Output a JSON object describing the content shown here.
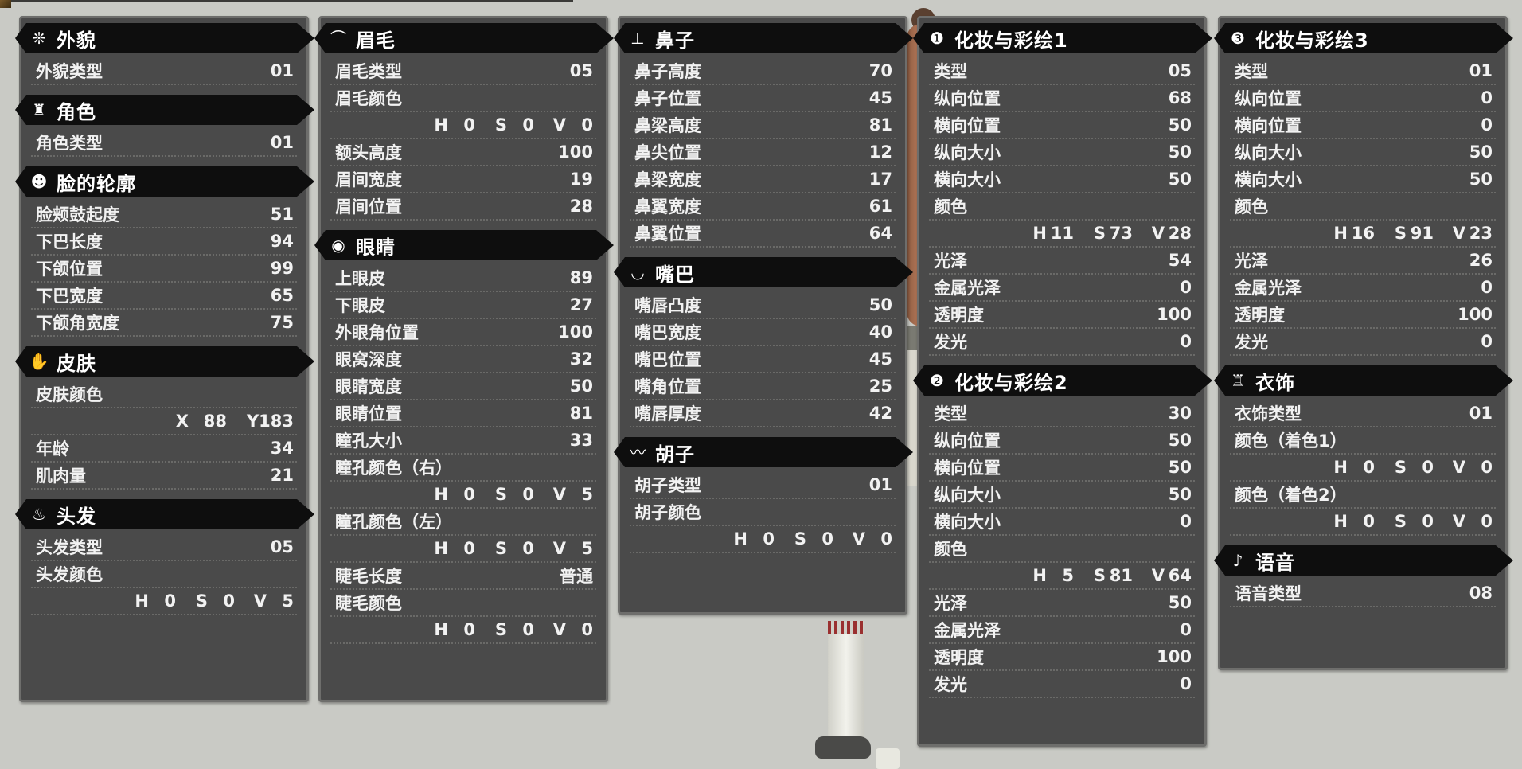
{
  "colors": {
    "panel": "#4a4a4a",
    "banner": "#0e0e0e",
    "text": "#f2f2f2",
    "background": "#c9cac5"
  },
  "col1": {
    "appearance": {
      "title": "外貌",
      "icon": "appearance-icon",
      "rows": [
        {
          "label": "外貌类型",
          "value": "01"
        }
      ]
    },
    "role": {
      "title": "角色",
      "icon": "character-icon",
      "rows": [
        {
          "label": "角色类型",
          "value": "01"
        }
      ]
    },
    "face": {
      "title": "脸的轮廓",
      "icon": "face-icon",
      "rows": [
        {
          "label": "脸颊鼓起度",
          "value": "51"
        },
        {
          "label": "下巴长度",
          "value": "94"
        },
        {
          "label": "下颌位置",
          "value": "99"
        },
        {
          "label": "下巴宽度",
          "value": "65"
        },
        {
          "label": "下颌角宽度",
          "value": "75"
        }
      ]
    },
    "skin": {
      "title": "皮肤",
      "icon": "hand-icon",
      "color_label": "皮肤颜色",
      "x_label": "X",
      "x_value": "88",
      "y_label": "Y183",
      "age": {
        "label": "年龄",
        "value": "34"
      },
      "muscle": {
        "label": "肌肉量",
        "value": "21"
      }
    },
    "hair": {
      "title": "头发",
      "icon": "hair-icon",
      "type": {
        "label": "头发类型",
        "value": "05"
      },
      "color_label": "头发颜色",
      "hsv": {
        "h": "0",
        "s": "0",
        "v": "5"
      }
    }
  },
  "col2": {
    "eyebrow": {
      "title": "眉毛",
      "icon": "eyebrow-icon",
      "type": {
        "label": "眉毛类型",
        "value": "05"
      },
      "color_label": "眉毛颜色",
      "hsv": {
        "h": "0",
        "s": "0",
        "v": "0"
      },
      "rows": [
        {
          "label": "额头高度",
          "value": "100"
        },
        {
          "label": "眉间宽度",
          "value": "19"
        },
        {
          "label": "眉间位置",
          "value": "28"
        }
      ]
    },
    "eyes": {
      "title": "眼睛",
      "icon": "eye-icon",
      "rows": [
        {
          "label": "上眼皮",
          "value": "89"
        },
        {
          "label": "下眼皮",
          "value": "27"
        },
        {
          "label": "外眼角位置",
          "value": "100"
        },
        {
          "label": "眼窝深度",
          "value": "32"
        },
        {
          "label": "眼睛宽度",
          "value": "50"
        },
        {
          "label": "眼睛位置",
          "value": "81"
        },
        {
          "label": "瞳孔大小",
          "value": "33"
        }
      ],
      "pupil_right_label": "瞳孔颜色（右）",
      "pupil_right_hsv": {
        "h": "0",
        "s": "0",
        "v": "5"
      },
      "pupil_left_label": "瞳孔颜色（左）",
      "pupil_left_hsv": {
        "h": "0",
        "s": "0",
        "v": "5"
      },
      "lash_length": {
        "label": "睫毛长度",
        "value": "普通"
      },
      "lash_color_label": "睫毛颜色",
      "lash_hsv": {
        "h": "0",
        "s": "0",
        "v": "0"
      }
    }
  },
  "col3": {
    "nose": {
      "title": "鼻子",
      "icon": "nose-icon",
      "rows": [
        {
          "label": "鼻子高度",
          "value": "70"
        },
        {
          "label": "鼻子位置",
          "value": "45"
        },
        {
          "label": "鼻梁高度",
          "value": "81"
        },
        {
          "label": "鼻尖位置",
          "value": "12"
        },
        {
          "label": "鼻梁宽度",
          "value": "17"
        },
        {
          "label": "鼻翼宽度",
          "value": "61"
        },
        {
          "label": "鼻翼位置",
          "value": "64"
        }
      ]
    },
    "mouth": {
      "title": "嘴巴",
      "icon": "mouth-icon",
      "rows": [
        {
          "label": "嘴唇凸度",
          "value": "50"
        },
        {
          "label": "嘴巴宽度",
          "value": "40"
        },
        {
          "label": "嘴巴位置",
          "value": "45"
        },
        {
          "label": "嘴角位置",
          "value": "25"
        },
        {
          "label": "嘴唇厚度",
          "value": "42"
        }
      ]
    },
    "beard": {
      "title": "胡子",
      "icon": "mustache-icon",
      "type": {
        "label": "胡子类型",
        "value": "01"
      },
      "color_label": "胡子颜色",
      "hsv": {
        "h": "0",
        "s": "0",
        "v": "0"
      }
    }
  },
  "col4": {
    "makeup1": {
      "title": "化妆与彩绘1",
      "icon": "makeup-1-icon",
      "rows_top": [
        {
          "label": "类型",
          "value": "05"
        },
        {
          "label": "纵向位置",
          "value": "68"
        },
        {
          "label": "横向位置",
          "value": "50"
        },
        {
          "label": "纵向大小",
          "value": "50"
        },
        {
          "label": "横向大小",
          "value": "50"
        }
      ],
      "color_label": "颜色",
      "hsv": {
        "h": "11",
        "s": "73",
        "v": "28"
      },
      "rows_bottom": [
        {
          "label": "光泽",
          "value": "54"
        },
        {
          "label": "金属光泽",
          "value": "0"
        },
        {
          "label": "透明度",
          "value": "100"
        },
        {
          "label": "发光",
          "value": "0"
        }
      ]
    },
    "makeup2": {
      "title": "化妆与彩绘2",
      "icon": "makeup-2-icon",
      "rows_top": [
        {
          "label": "类型",
          "value": "30"
        },
        {
          "label": "纵向位置",
          "value": "50"
        },
        {
          "label": "横向位置",
          "value": "50"
        },
        {
          "label": "纵向大小",
          "value": "50"
        },
        {
          "label": "横向大小",
          "value": "0"
        }
      ],
      "color_label": "颜色",
      "hsv": {
        "h": "5",
        "s": "81",
        "v": "64"
      },
      "rows_bottom": [
        {
          "label": "光泽",
          "value": "50"
        },
        {
          "label": "金属光泽",
          "value": "0"
        },
        {
          "label": "透明度",
          "value": "100"
        },
        {
          "label": "发光",
          "value": "0"
        }
      ]
    }
  },
  "col5": {
    "makeup3": {
      "title": "化妆与彩绘3",
      "icon": "makeup-3-icon",
      "rows_top": [
        {
          "label": "类型",
          "value": "01"
        },
        {
          "label": "纵向位置",
          "value": "0"
        },
        {
          "label": "横向位置",
          "value": "0"
        },
        {
          "label": "纵向大小",
          "value": "50"
        },
        {
          "label": "横向大小",
          "value": "50"
        }
      ],
      "color_label": "颜色",
      "hsv": {
        "h": "16",
        "s": "91",
        "v": "23"
      },
      "rows_bottom": [
        {
          "label": "光泽",
          "value": "26"
        },
        {
          "label": "金属光泽",
          "value": "0"
        },
        {
          "label": "透明度",
          "value": "100"
        },
        {
          "label": "发光",
          "value": "0"
        }
      ]
    },
    "outfit": {
      "title": "衣饰",
      "icon": "outfit-icon",
      "type": {
        "label": "衣饰类型",
        "value": "01"
      },
      "color1_label": "颜色（着色1）",
      "color1_hsv": {
        "h": "0",
        "s": "0",
        "v": "0"
      },
      "color2_label": "颜色（着色2）",
      "color2_hsv": {
        "h": "0",
        "s": "0",
        "v": "0"
      }
    },
    "voice": {
      "title": "语音",
      "icon": "voice-icon",
      "type": {
        "label": "语音类型",
        "value": "08"
      }
    }
  },
  "hsv_labels": {
    "h": "H",
    "s": "S",
    "v": "V"
  }
}
